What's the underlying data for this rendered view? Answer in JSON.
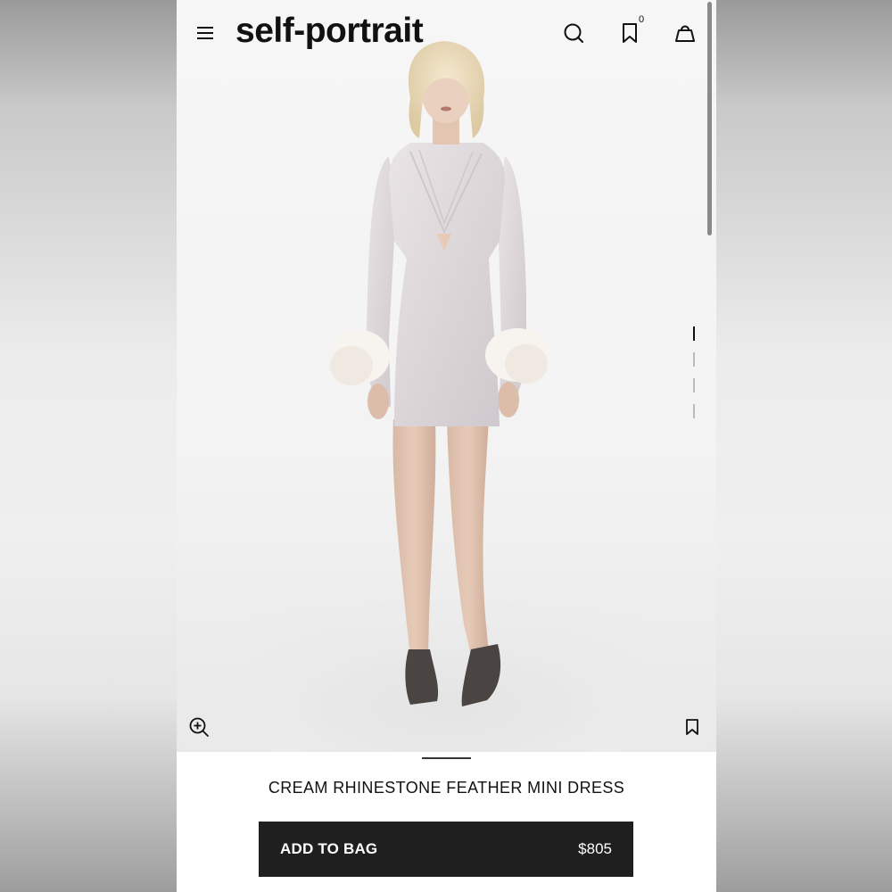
{
  "header": {
    "brand": "self-portrait",
    "wishlist_count": "0",
    "icons": [
      "hamburger-icon",
      "search-icon",
      "bookmark-icon",
      "shopping-bag-icon"
    ]
  },
  "gallery": {
    "image_count": 4,
    "active_index": 0,
    "icons": [
      "zoom-in-icon",
      "bookmark-icon"
    ]
  },
  "product": {
    "title": "CREAM RHINESTONE FEATHER MINI DRESS",
    "add_to_bag_label": "ADD TO BAG",
    "price": "$805"
  },
  "colors": {
    "button_bg": "#1f1f1f",
    "text": "#111111"
  }
}
